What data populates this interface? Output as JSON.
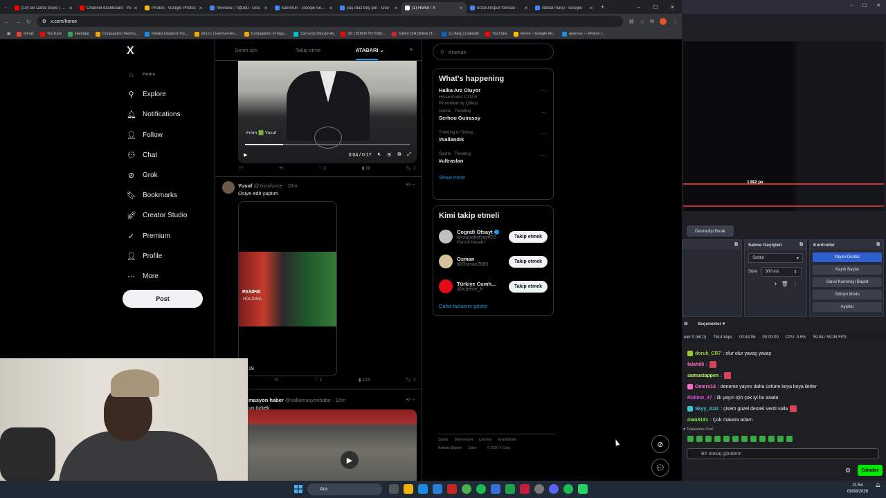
{
  "browser": {
    "tabs": [
      {
        "label": "(19) Bir Daha Söyle | Go",
        "color": "#ff0000"
      },
      {
        "label": "Channel dashboard - Yo",
        "color": "#ff0000"
      },
      {
        "label": "Photos - Google Photos",
        "color": "#fbbc04"
      },
      {
        "label": "mevlana 7 öğüdü - Goo",
        "color": "#4285f4"
      },
      {
        "label": "kamerun - Google Searc",
        "color": "#4285f4"
      },
      {
        "label": "yaş otuz beş şiiri - Goo",
        "color": "#4285f4"
      },
      {
        "label": "(1) Home / X",
        "color": "#ffffff"
      },
      {
        "label": "erzurumspor forması - ",
        "color": "#4285f4"
      },
      {
        "label": "istiklal marşı - Google",
        "color": "#4285f4"
      }
    ],
    "active_tab": 6,
    "url": "x.com/home",
    "bookmarks": [
      "Gmail",
      "YouTube",
      "Haritalar",
      "Conjugation Germa...",
      "heluka Deutsch-Tür...",
      "dict.cc | German-En...",
      "Conjugation of regu...",
      "Canva'ta Oturum Aç",
      "(9) LISTEN TO THIS...",
      "Gleim CIA Online (T...",
      "(1) Akış | LinkedIn",
      "YouTube",
      "Home – Google Ad...",
      "anemos — Motion t..."
    ]
  },
  "x": {
    "logo": "X",
    "nav": [
      {
        "label": "Home",
        "icon": "home-icon",
        "glyph": "⌂"
      },
      {
        "label": "Explore",
        "icon": "search-icon",
        "glyph": "⚲"
      },
      {
        "label": "Notifications",
        "icon": "bell-icon",
        "glyph": "🔔︎"
      },
      {
        "label": "Follow",
        "icon": "person-add-icon",
        "glyph": "👤︎"
      },
      {
        "label": "Chat",
        "icon": "chat-icon",
        "glyph": "💬︎"
      },
      {
        "label": "Grok",
        "icon": "grok-icon",
        "glyph": "⊘"
      },
      {
        "label": "Bookmarks",
        "icon": "bookmark-icon",
        "glyph": "🔖︎"
      },
      {
        "label": "Creator Studio",
        "icon": "rocket-icon",
        "glyph": "🚀︎"
      },
      {
        "label": "Premium",
        "icon": "check-badge-icon",
        "glyph": "✓"
      },
      {
        "label": "Profile",
        "icon": "profile-icon",
        "glyph": "👤︎"
      },
      {
        "label": "More",
        "icon": "more-icon",
        "glyph": "⋯"
      }
    ],
    "post_button": "Post",
    "feed_tabs": [
      "Senin için",
      "Takip etme",
      "ATABARI"
    ],
    "post1": {
      "from": "From 🟩 Yusuf",
      "time": "0:04 / 0:17",
      "likes": "2",
      "views": "90"
    },
    "post2": {
      "name": "Yusuf",
      "handle": "@Yusufzvce · 10m",
      "text": "Osiye edit yaptım",
      "overlay1": "PASIFIK",
      "overlay2": "HOLDING",
      "count": "19",
      "likes": "1",
      "views": "124"
    },
    "post3": {
      "name": "masyon haber",
      "handle": "@sallamasyonhabe · 10m",
      "text": "un özkek"
    },
    "search_placeholder": "Aramak",
    "trends_title": "What's happening",
    "trends": [
      {
        "category": "",
        "name": "Halka Arz Oluyor",
        "sub": "Hisse Kodu: CITAS",
        "promo": "Promoted by Çitleçi"
      },
      {
        "category": "Sports · Trending",
        "name": "Serhou Guirassy",
        "sub": "",
        "promo": ""
      },
      {
        "category": "Trending in Turkey",
        "name": "#sallandık",
        "sub": "",
        "promo": ""
      },
      {
        "category": "Sports · Trending",
        "name": "#ultraslan",
        "sub": "",
        "promo": ""
      }
    ],
    "show_more": "Show more",
    "who_title": "Kimi takip etmeli",
    "who": [
      {
        "name": "Cografi Ofsayt",
        "handle": "@cografiofsaytGS",
        "extra": "Parodi hesabı",
        "button": "Takip etmek",
        "color": "#c0c0c0"
      },
      {
        "name": "Osman",
        "handle": "@Osman2660",
        "extra": "",
        "button": "Takip etmek",
        "color": "#d6c29a"
      },
      {
        "name": "Türkiye Cumh...",
        "handle": "@tcbeste_fr",
        "extra": "",
        "button": "Takip etmek",
        "color": "#e30a17"
      }
    ],
    "who_more": "Daha fazlasını göster",
    "footer": [
      "Şartlar",
      "Mahremiyet",
      "Çerezler",
      "Erişilebilirlik",
      "Reklam Bilgileri",
      "Daha ···",
      "© 2026 X Corp."
    ]
  },
  "obs": {
    "devret": "Devredişi Bırak",
    "px": "1382 px",
    "scene_transitions": "Sahne Geçişleri",
    "transition": "Soldur",
    "duration_label": "Süre",
    "duration": "300 ms",
    "controls": "Kontroller",
    "buttons": [
      "Yayını Durdur",
      "Kaydı Başlat",
      "Sanal Kamerayı Başlat",
      "Stüdyo Modu",
      "Ayarlar"
    ],
    "options": "Seçenekler",
    "status": [
      "eler 0 (60.0)",
      "7614 kbps",
      "00:44:06",
      "00:00:00",
      "CPU: 4.5%",
      "59.94 / 59.94 FPS"
    ]
  },
  "chat": {
    "messages": [
      {
        "user": "doruk_CR7",
        "color": "#9acd32",
        "text": ": olur olur yavaş yavaş"
      },
      {
        "user": "falah88",
        "color": "#ff69b4",
        "text": ":"
      },
      {
        "user": "samustappen",
        "color": "#b4ff5a",
        "text": ":"
      },
      {
        "user": "Omerx18",
        "color": "#ff66cc",
        "text": ": deneme yayını daha üstüne koya koya ilerler"
      },
      {
        "user": "Robinn_47",
        "color": "#e24ce2",
        "text": ": ilk yayın için çok iyi bu arada"
      },
      {
        "user": "Skyy_Aziz",
        "color": "#37c6d7",
        "text": ": çisem güzel destek verdi valla"
      },
      {
        "user": "man3131",
        "color": "#7cff4d",
        "text": ": Çok makara adam"
      }
    ],
    "label": "Takipçilere Özel",
    "placeholder": "Bir mesaj gönderin",
    "send": "Gönder"
  },
  "taskbar": {
    "search": "Ara",
    "time": "21:54",
    "date": "09/08/2026"
  }
}
